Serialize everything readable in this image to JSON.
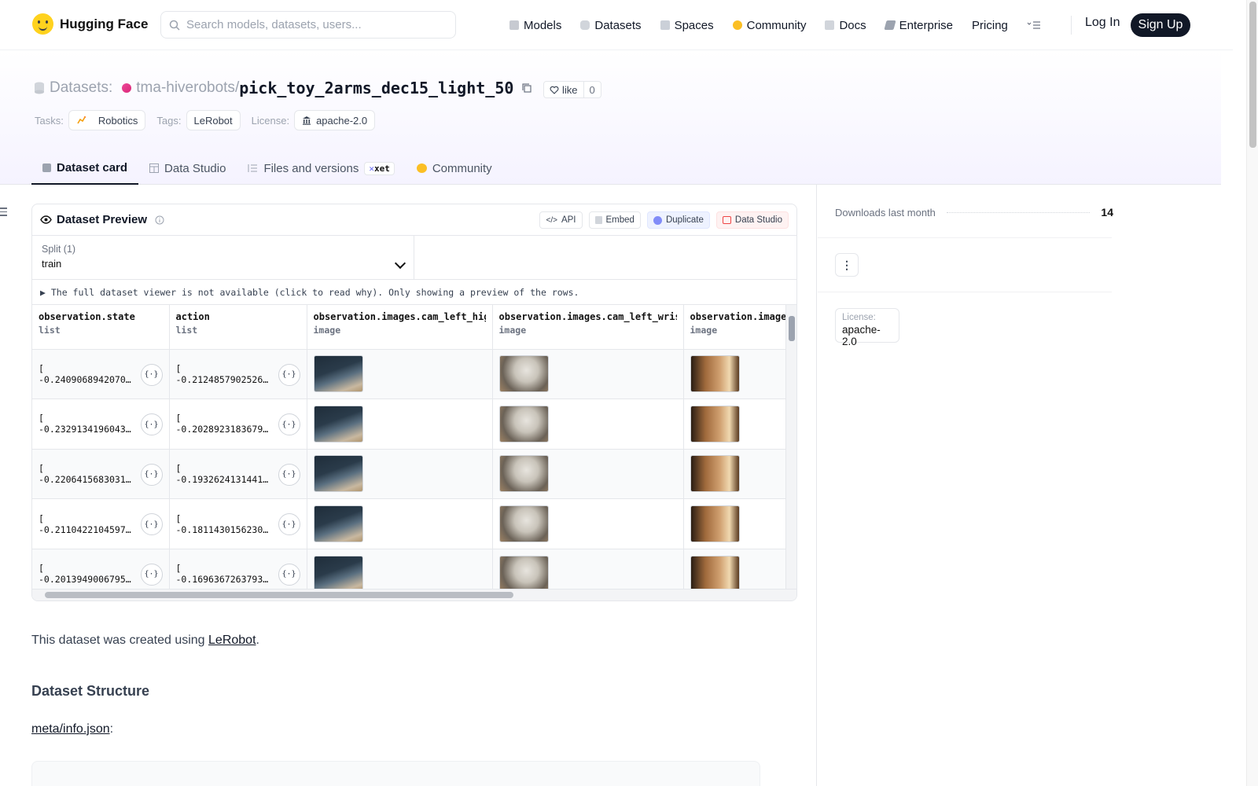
{
  "header": {
    "brand": "Hugging Face",
    "search_placeholder": "Search models, datasets, users...",
    "nav": [
      {
        "label": "Models",
        "icon": "cube-icon",
        "color": "#9ca3af"
      },
      {
        "label": "Datasets",
        "icon": "database-icon",
        "color": "#9ca3af"
      },
      {
        "label": "Spaces",
        "icon": "grid-icon",
        "color": "#9ca3af"
      },
      {
        "label": "Community",
        "icon": "community-icon",
        "color": "#fbbf24"
      },
      {
        "label": "Docs",
        "icon": "book-icon",
        "color": "#9ca3af"
      },
      {
        "label": "Enterprise",
        "icon": "enterprise-icon",
        "color": "#6b7280"
      },
      {
        "label": "Pricing",
        "icon": "",
        "color": ""
      }
    ],
    "login": "Log In",
    "signup": "Sign Up"
  },
  "repo": {
    "kind": "Datasets:",
    "owner": "tma-hiverobots",
    "separator": "/",
    "name": "pick_toy_2arms_dec15_light_50",
    "like_label": "like",
    "like_count": "0",
    "tasks_label": "Tasks:",
    "task": "Robotics",
    "tags_label": "Tags:",
    "tag": "LeRobot",
    "license_label": "License:",
    "license": "apache-2.0"
  },
  "tabs": [
    {
      "label": "Dataset card",
      "active": true
    },
    {
      "label": "Data Studio",
      "active": false
    },
    {
      "label": "Files and versions",
      "active": false,
      "badge": "xet"
    },
    {
      "label": "Community",
      "active": false
    }
  ],
  "preview": {
    "title": "Dataset Preview",
    "actions": [
      "API",
      "Embed",
      "Duplicate",
      "Data Studio"
    ],
    "split_label": "Split (1)",
    "split_value": "train",
    "notice": "▶ The full dataset viewer is not available (click to read why). Only showing a preview of the rows.",
    "columns": [
      {
        "name": "observation.state",
        "type": "list"
      },
      {
        "name": "action",
        "type": "list"
      },
      {
        "name": "observation.images.cam_left_high",
        "type": "image"
      },
      {
        "name": "observation.images.cam_left_wrist",
        "type": "image"
      },
      {
        "name": "observation.images",
        "type": "image"
      }
    ],
    "rows": [
      {
        "state": "-0.2409068942070…",
        "action": "-0.2124857902526…"
      },
      {
        "state": "-0.2329134196043…",
        "action": "-0.2028923183679…"
      },
      {
        "state": "-0.2206415683031…",
        "action": "-0.1932624131441…"
      },
      {
        "state": "-0.2110422104597…",
        "action": "-0.1811430156230…"
      },
      {
        "state": "-0.2013949006795…",
        "action": "-0.1696367263793…"
      }
    ],
    "list_open": "[",
    "json_btn": "{·}"
  },
  "readme": {
    "intro_before": "This dataset was created using ",
    "intro_link": "LeRobot",
    "intro_after": ".",
    "structure_heading": "Dataset Structure",
    "meta_link": "meta/info.json",
    "meta_after": ":"
  },
  "sidebar": {
    "downloads_label": "Downloads last month",
    "downloads_value": "14",
    "kebab": "⋮",
    "license_label": "License:",
    "license_value": "apache-2.0"
  }
}
